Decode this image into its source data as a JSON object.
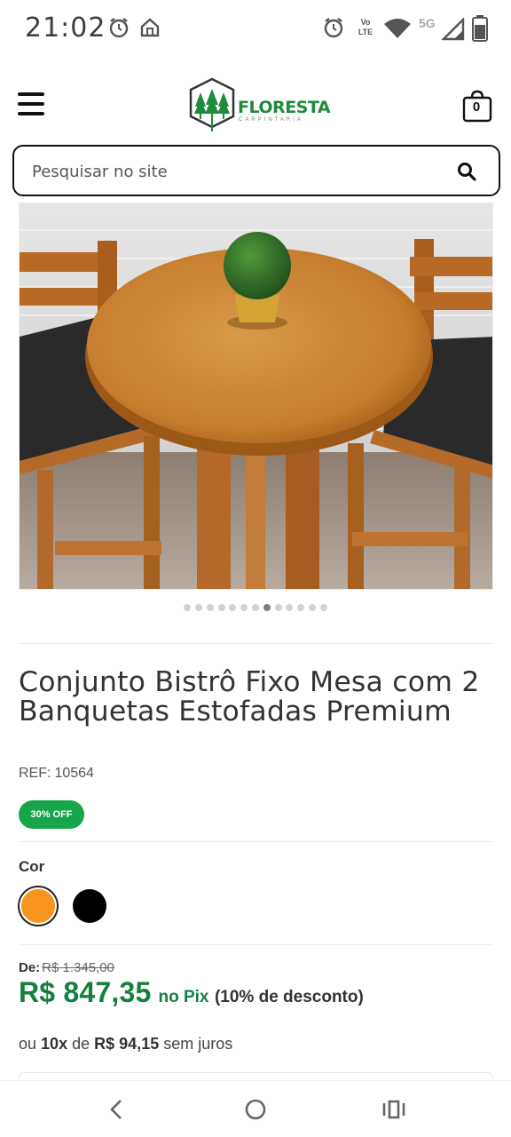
{
  "status_bar": {
    "time": "21:02",
    "network": "5G",
    "volte": "Vo LTE",
    "icons": [
      "alarm-icon",
      "home-icon",
      "alarm-icon",
      "volte-icon",
      "wifi-icon",
      "signal-icon",
      "battery-icon"
    ]
  },
  "header": {
    "logo_text": "FLORESTA",
    "logo_subtext": "CARPINTARIA",
    "cart_count": "0"
  },
  "search": {
    "placeholder": "Pesquisar no site"
  },
  "carousel": {
    "total": 13,
    "active_index": 7
  },
  "product": {
    "title": "Conjunto Bistrô Fixo Mesa com 2 Banquetas Estofadas Premium",
    "ref_label": "REF:",
    "ref_value": "10564",
    "discount_badge": "30% OFF",
    "color_label": "Cor",
    "colors": [
      {
        "name": "laranja",
        "hex": "#f7951e",
        "selected": true
      },
      {
        "name": "preto",
        "hex": "#000000",
        "selected": false
      }
    ],
    "old_price_label": "De:",
    "old_price": "R$ 1.345,00",
    "price": "R$ 847,35",
    "pix_label": "no Pix",
    "pix_discount": "(10% de desconto)",
    "installments": {
      "prefix": "ou",
      "count": "10x",
      "de": "de",
      "value": "R$ 94,15",
      "suffix": "sem juros"
    }
  },
  "colors": {
    "brand_green": "#15803d",
    "badge_green": "#18a64a"
  }
}
